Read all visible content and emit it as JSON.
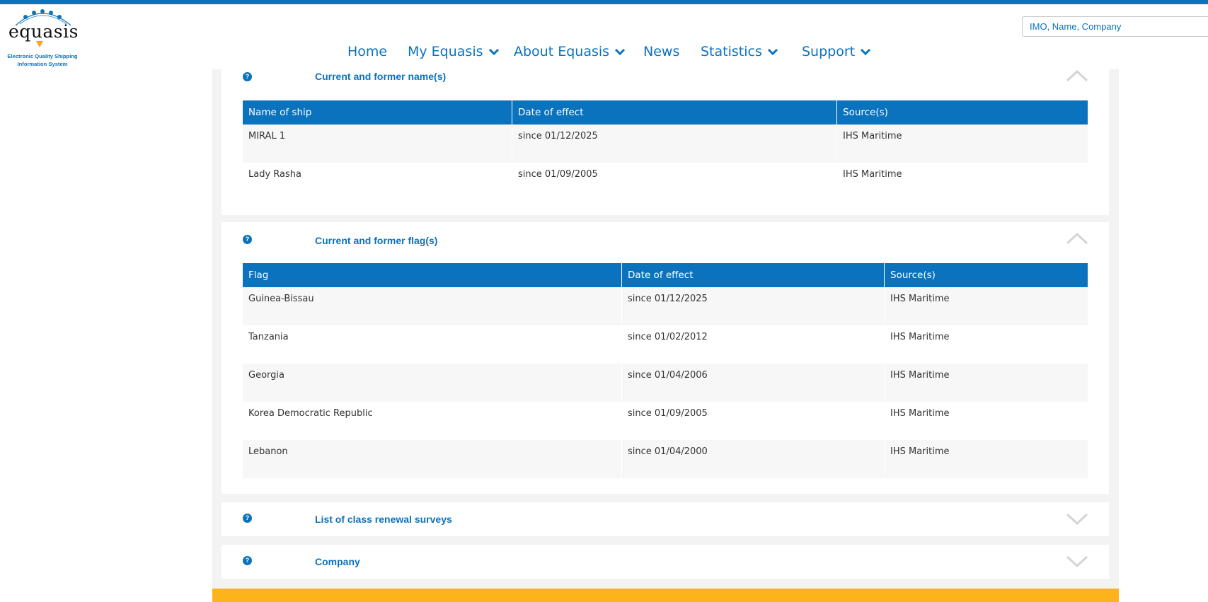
{
  "header": {
    "logo": {
      "name": "equasis",
      "tagline_line1": "Electronic Quality Shipping",
      "tagline_line2": "Information System"
    },
    "search": {
      "placeholder": "IMO, Name, Company",
      "value": ""
    },
    "nav": [
      {
        "label": "Home",
        "has_dropdown": false
      },
      {
        "label": "My Equasis",
        "has_dropdown": true
      },
      {
        "label": "About Equasis",
        "has_dropdown": true
      },
      {
        "label": "News",
        "has_dropdown": false
      },
      {
        "label": "Statistics",
        "has_dropdown": true
      },
      {
        "label": "Support",
        "has_dropdown": true
      }
    ]
  },
  "sections": {
    "names": {
      "title": "Current and former name(s)",
      "expanded": true,
      "columns": [
        "Name of ship",
        "Date of effect",
        "Source(s)"
      ],
      "rows": [
        [
          "MIRAL 1",
          "since 01/12/2025",
          "IHS Maritime"
        ],
        [
          "Lady Rasha",
          "since 01/09/2005",
          "IHS Maritime"
        ]
      ]
    },
    "flags": {
      "title": "Current and former flag(s)",
      "expanded": true,
      "columns": [
        "Flag",
        "Date of effect",
        "Source(s)"
      ],
      "rows": [
        [
          "Guinea-Bissau",
          "since 01/12/2025",
          "IHS Maritime"
        ],
        [
          "Tanzania",
          "since 01/02/2012",
          "IHS Maritime"
        ],
        [
          "Georgia",
          "since 01/04/2006",
          "IHS Maritime"
        ],
        [
          "Korea Democratic Republic",
          "since 01/09/2005",
          "IHS Maritime"
        ],
        [
          "Lebanon",
          "since 01/04/2000",
          "IHS Maritime"
        ]
      ]
    },
    "class_surveys": {
      "title": "List of class renewal surveys",
      "expanded": false
    },
    "company": {
      "title": "Company",
      "expanded": false
    }
  },
  "help_icon": "?",
  "colors": {
    "brand_blue": "#0b72be",
    "accent_orange": "#fcb31c",
    "panel_bg": "#f3f3f3"
  }
}
